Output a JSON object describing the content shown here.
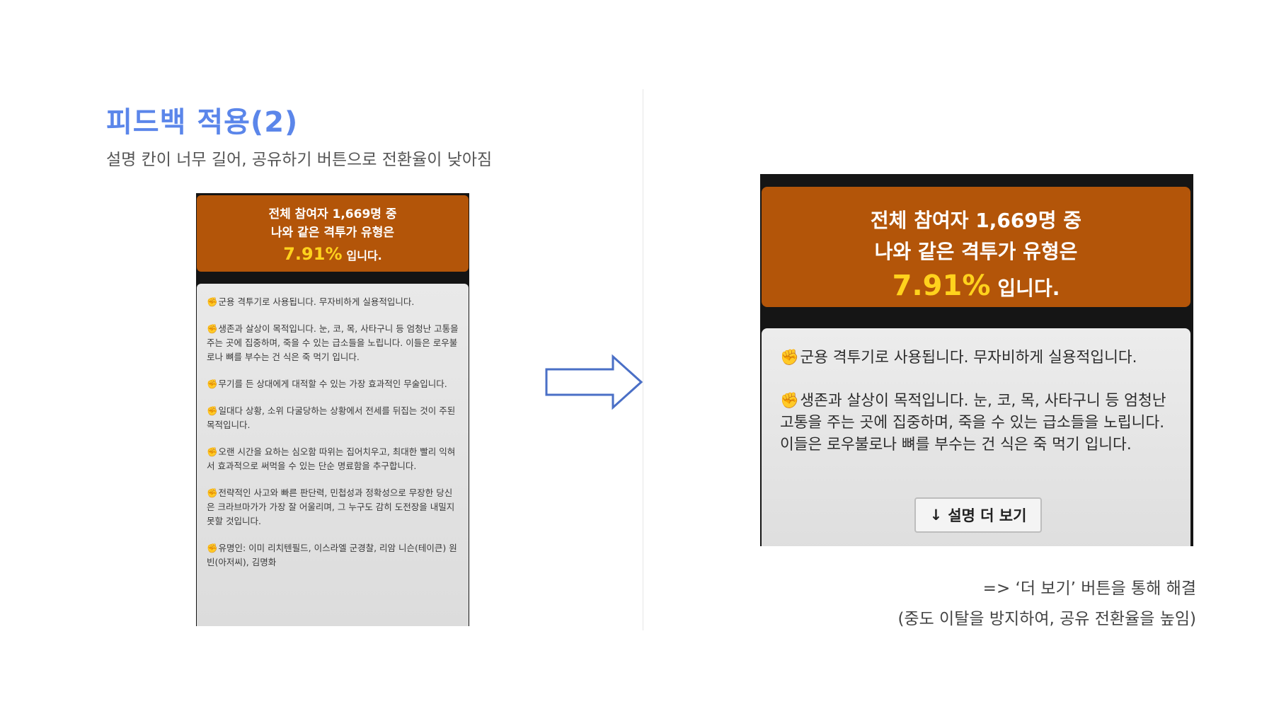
{
  "header": {
    "title": "피드백 적용(2)",
    "subtitle": "설명 칸이 너무 길어, 공유하기 버튼으로 전환율이 낮아짐"
  },
  "before": {
    "banner": {
      "line1": "전체 참여자 1,669명 중",
      "line2": "나와 같은 격투가 유형은",
      "percent": "7.91%",
      "suffix": "입니다."
    },
    "paragraphs": [
      "군용 격투기로 사용됩니다. 무자비하게 실용적입니다.",
      "생존과 살상이 목적입니다. 눈, 코, 목, 사타구니 등 엄청난 고통을 주는 곳에 집중하며, 죽을 수 있는 급소들을 노립니다. 이들은 로우불로나 뼈를 부수는 건 식은 죽 먹기 입니다.",
      "무기를 든 상대에게 대적할 수 있는 가장 효과적인 무술입니다.",
      "일대다 상황, 소위 다굴당하는 상황에서 전세를 뒤집는 것이 주된 목적입니다.",
      "오랜 시간을 요하는 심오함 따위는 집어치우고, 최대한 빨리 익혀서 효과적으로 써먹을 수 있는 단순 명료함을 추구합니다.",
      "전략적인 사고와 빠른 판단력, 민첩성과 정확성으로 무장한 당신은 크라브마가가 가장 잘 어울리며, 그 누구도 감히 도전장을 내밀지 못할 것입니다.",
      "유명인: 이미 리치텐필드, 이스라엘 군경찰, 리암 니슨(테이큰) 원빈(아저씨), 김명화"
    ]
  },
  "after": {
    "banner": {
      "line1": "전체 참여자 1,669명 중",
      "line2": "나와 같은 격투가 유형은",
      "percent": "7.91%",
      "suffix": "입니다."
    },
    "paragraphs": [
      "군용 격투기로 사용됩니다. 무자비하게 실용적입니다.",
      "생존과 살상이 목적입니다. 눈, 코, 목, 사타구니 등 엄청난 고통을 주는 곳에 집중하며, 죽을 수 있는 급소들을 노립니다. 이들은 로우불로나 뼈를 부수는 건 식은 죽 먹기 입니다."
    ],
    "more_button": {
      "icon": "↓",
      "label": "설명 더 보기"
    }
  },
  "bullet_icon": "✊",
  "notes": {
    "line1": "=> ‘더 보기’ 버튼을 통해 해결",
    "line2": "(중도 이탈을 방지하여, 공유 전환율을 높임)"
  },
  "colors": {
    "title": "#5b86ea",
    "banner": "#b35509",
    "percent": "#ffd21d",
    "arrow": "#4a6fc6"
  }
}
